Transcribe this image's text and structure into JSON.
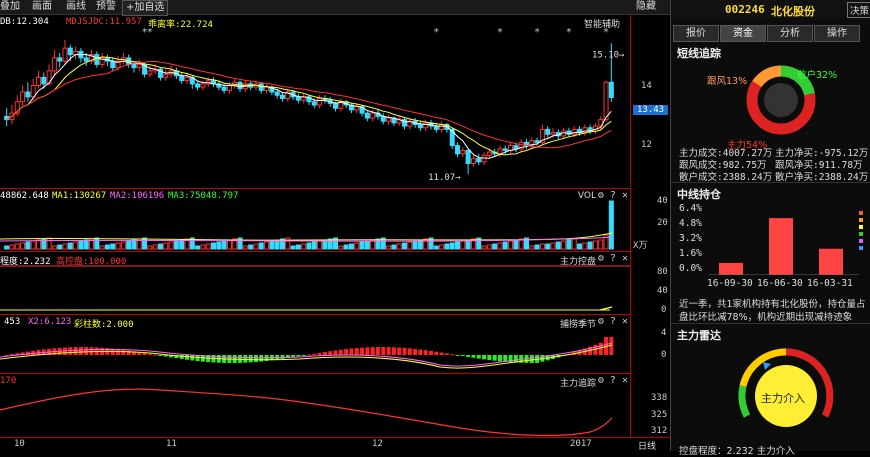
{
  "toolbar": {
    "items": [
      "叠加",
      "画面",
      "画线",
      "预警"
    ],
    "add_self": "+加自选",
    "hide": "隐藏"
  },
  "main_indicator": {
    "lines": [
      {
        "text": "DB:12.304",
        "color": "#ffffff"
      },
      {
        "text": "MDJSJDC:11.957",
        "color": "#ff3333"
      },
      {
        "text": "乖离率:22.724",
        "color": "#ffff33"
      }
    ],
    "helper": "智能辅助",
    "price_labels": [
      "14",
      "13.43",
      "12"
    ],
    "current_price": "13.43",
    "high_note": "15.10",
    "low_note": "11.07"
  },
  "chart_data": {
    "type": "candlestick",
    "title": "",
    "y_range": [
      10.8,
      15.6
    ],
    "x_ticks": [
      "10",
      "11",
      "12",
      "2017"
    ],
    "x_tick_index": [
      2,
      32,
      72,
      113
    ],
    "high_mark": {
      "index": 116,
      "value": 15.1
    },
    "low_mark": {
      "index": 87,
      "value": 11.07
    },
    "candles": [
      [
        12.85,
        12.75,
        13.1,
        12.55
      ],
      [
        12.75,
        12.95,
        13.2,
        12.6
      ],
      [
        12.95,
        13.3,
        13.5,
        12.85
      ],
      [
        13.3,
        13.6,
        13.8,
        13.2
      ],
      [
        13.6,
        13.45,
        13.9,
        13.3
      ],
      [
        13.45,
        13.8,
        14.0,
        13.35
      ],
      [
        13.8,
        14.05,
        14.25,
        13.7
      ],
      [
        14.05,
        13.85,
        14.2,
        13.7
      ],
      [
        13.85,
        14.25,
        14.45,
        13.8
      ],
      [
        14.25,
        14.65,
        14.9,
        14.1
      ],
      [
        14.65,
        14.55,
        14.8,
        14.35
      ],
      [
        14.55,
        14.95,
        15.2,
        14.45
      ],
      [
        14.95,
        14.75,
        15.05,
        14.55
      ],
      [
        14.75,
        14.85,
        15.0,
        14.6
      ],
      [
        14.85,
        14.65,
        14.95,
        14.5
      ],
      [
        14.65,
        14.55,
        14.8,
        14.4
      ],
      [
        14.55,
        14.75,
        14.9,
        14.45
      ],
      [
        14.75,
        14.45,
        14.85,
        14.35
      ],
      [
        14.45,
        14.65,
        14.8,
        14.35
      ],
      [
        14.65,
        14.55,
        14.75,
        14.4
      ],
      [
        14.55,
        14.35,
        14.65,
        14.25
      ],
      [
        14.35,
        14.55,
        14.7,
        14.25
      ],
      [
        14.55,
        14.65,
        14.8,
        14.45
      ],
      [
        14.65,
        14.45,
        14.75,
        14.35
      ],
      [
        14.45,
        14.35,
        14.55,
        14.2
      ],
      [
        14.35,
        14.45,
        14.6,
        14.25
      ],
      [
        14.45,
        14.15,
        14.5,
        14.05
      ],
      [
        14.15,
        14.25,
        14.4,
        14.05
      ],
      [
        14.25,
        14.3,
        14.45,
        14.15
      ],
      [
        14.3,
        14.05,
        14.35,
        13.95
      ],
      [
        14.05,
        14.15,
        14.3,
        13.95
      ],
      [
        14.15,
        14.25,
        14.4,
        14.05
      ],
      [
        14.25,
        14.1,
        14.35,
        14.0
      ],
      [
        14.1,
        13.95,
        14.2,
        13.85
      ],
      [
        13.95,
        14.05,
        14.15,
        13.85
      ],
      [
        14.05,
        13.85,
        14.1,
        13.7
      ],
      [
        13.85,
        13.75,
        13.95,
        13.65
      ],
      [
        13.75,
        13.85,
        13.95,
        13.65
      ],
      [
        13.85,
        13.95,
        14.05,
        13.75
      ],
      [
        13.95,
        13.85,
        14.05,
        13.75
      ],
      [
        13.85,
        13.75,
        13.95,
        13.65
      ],
      [
        13.75,
        13.65,
        13.85,
        13.55
      ],
      [
        13.65,
        13.8,
        13.9,
        13.55
      ],
      [
        13.8,
        13.9,
        14.0,
        13.7
      ],
      [
        13.9,
        13.7,
        13.95,
        13.6
      ],
      [
        13.7,
        13.85,
        13.95,
        13.6
      ],
      [
        13.85,
        13.75,
        13.95,
        13.65
      ],
      [
        13.75,
        13.85,
        13.95,
        13.65
      ],
      [
        13.85,
        13.65,
        13.9,
        13.55
      ],
      [
        13.65,
        13.75,
        13.85,
        13.55
      ],
      [
        13.75,
        13.6,
        13.8,
        13.5
      ],
      [
        13.6,
        13.5,
        13.7,
        13.4
      ],
      [
        13.5,
        13.4,
        13.6,
        13.3
      ],
      [
        13.4,
        13.6,
        13.7,
        13.3
      ],
      [
        13.6,
        13.45,
        13.65,
        13.35
      ],
      [
        13.45,
        13.35,
        13.55,
        13.25
      ],
      [
        13.35,
        13.45,
        13.55,
        13.25
      ],
      [
        13.45,
        13.3,
        13.5,
        13.2
      ],
      [
        13.3,
        13.2,
        13.4,
        13.1
      ],
      [
        13.2,
        13.4,
        13.5,
        13.1
      ],
      [
        13.4,
        13.35,
        13.5,
        13.25
      ],
      [
        13.35,
        13.25,
        13.45,
        13.15
      ],
      [
        13.25,
        13.1,
        13.3,
        13.0
      ],
      [
        13.1,
        13.3,
        13.4,
        13.0
      ],
      [
        13.3,
        13.2,
        13.35,
        13.1
      ],
      [
        13.2,
        13.05,
        13.25,
        12.95
      ],
      [
        13.05,
        13.15,
        13.25,
        12.95
      ],
      [
        13.15,
        12.95,
        13.2,
        12.85
      ],
      [
        12.95,
        12.8,
        13.0,
        12.7
      ],
      [
        12.8,
        12.95,
        13.05,
        12.7
      ],
      [
        12.95,
        12.85,
        13.05,
        12.75
      ],
      [
        12.85,
        12.7,
        12.95,
        12.6
      ],
      [
        12.7,
        12.8,
        12.9,
        12.6
      ],
      [
        12.8,
        12.65,
        12.85,
        12.55
      ],
      [
        12.65,
        12.75,
        12.85,
        12.55
      ],
      [
        12.75,
        12.55,
        12.8,
        12.45
      ],
      [
        12.55,
        12.7,
        12.8,
        12.45
      ],
      [
        12.7,
        12.6,
        12.8,
        12.5
      ],
      [
        12.6,
        12.5,
        12.7,
        12.4
      ],
      [
        12.5,
        12.65,
        12.75,
        12.4
      ],
      [
        12.65,
        12.55,
        12.75,
        12.45
      ],
      [
        12.55,
        12.45,
        12.65,
        12.35
      ],
      [
        12.45,
        12.6,
        12.7,
        12.35
      ],
      [
        12.6,
        12.45,
        12.65,
        12.35
      ],
      [
        12.45,
        11.95,
        12.5,
        11.85
      ],
      [
        11.95,
        11.7,
        12.05,
        11.6
      ],
      [
        11.7,
        11.8,
        11.9,
        11.6
      ],
      [
        11.8,
        11.4,
        11.85,
        11.07
      ],
      [
        11.4,
        11.55,
        11.65,
        11.3
      ],
      [
        11.55,
        11.45,
        11.7,
        11.35
      ],
      [
        11.45,
        11.65,
        11.75,
        11.35
      ],
      [
        11.65,
        11.75,
        11.85,
        11.55
      ],
      [
        11.75,
        11.7,
        11.85,
        11.6
      ],
      [
        11.7,
        11.85,
        11.95,
        11.6
      ],
      [
        11.85,
        11.8,
        11.95,
        11.7
      ],
      [
        11.8,
        11.95,
        12.05,
        11.7
      ],
      [
        11.95,
        11.85,
        12.05,
        11.75
      ],
      [
        11.85,
        12.05,
        12.15,
        11.75
      ],
      [
        12.05,
        11.95,
        12.15,
        11.85
      ],
      [
        11.95,
        12.1,
        12.2,
        11.85
      ],
      [
        12.1,
        12.05,
        12.2,
        11.95
      ],
      [
        12.05,
        12.45,
        12.6,
        12.0
      ],
      [
        12.45,
        12.3,
        12.55,
        12.2
      ],
      [
        12.3,
        12.35,
        12.5,
        12.2
      ],
      [
        12.35,
        12.25,
        12.45,
        12.15
      ],
      [
        12.25,
        12.4,
        12.5,
        12.15
      ],
      [
        12.4,
        12.3,
        12.5,
        12.2
      ],
      [
        12.3,
        12.45,
        12.55,
        12.2
      ],
      [
        12.45,
        12.35,
        12.55,
        12.25
      ],
      [
        12.35,
        12.5,
        12.6,
        12.25
      ],
      [
        12.5,
        12.4,
        12.6,
        12.3
      ],
      [
        12.4,
        12.55,
        12.65,
        12.3
      ],
      [
        12.55,
        12.75,
        12.85,
        12.45
      ],
      [
        12.75,
        13.9,
        13.95,
        12.7
      ],
      [
        13.9,
        13.43,
        15.1,
        13.3
      ]
    ],
    "ma_lines": [
      {
        "name": "MA5",
        "color": "#ffffff",
        "values": []
      },
      {
        "name": "MA10",
        "color": "#ffff33",
        "values": []
      },
      {
        "name": "MA20",
        "color": "#ff3333",
        "values": []
      }
    ]
  },
  "volume_pane": {
    "lines": [
      {
        "text": "48862.648",
        "color": "#ffffff"
      },
      {
        "text": "MA1:130267",
        "color": "#ffff33"
      },
      {
        "text": "MA2:106196",
        "color": "#ff66ff"
      },
      {
        "text": "MA3:75048.797",
        "color": "#33ff33"
      }
    ],
    "title": "VOL",
    "y_labels": [
      "40",
      "20"
    ],
    "unit": "X万"
  },
  "control_pane": {
    "lines": [
      {
        "text": "程度:2.232",
        "color": "#ffffff"
      },
      {
        "text": "高控盘:100.000",
        "color": "#ff3333"
      }
    ],
    "title": "主力控盘",
    "y_labels": [
      "80",
      "40",
      "0"
    ]
  },
  "season_pane": {
    "lines": [
      {
        "text": "453",
        "color": "#ffffff"
      },
      {
        "text": "X2:6.123",
        "color": "#ff66ff"
      },
      {
        "text": "彩柱数:2.000",
        "color": "#ffff33"
      }
    ],
    "title": "捕捞季节",
    "y_labels": [
      "4",
      "0"
    ]
  },
  "track_pane": {
    "lines": [
      {
        "text": "170",
        "color": "#ff3333"
      }
    ],
    "title": "主力追踪",
    "y_labels": [
      "338",
      "325",
      "312"
    ]
  },
  "x_axis": {
    "labels": [
      "10",
      "11",
      "12",
      "2017"
    ],
    "period": "日线"
  },
  "right_panel": {
    "stock_code": "002246",
    "stock_name": "北化股份",
    "decide_btn": "决策",
    "tabs": [
      "报价",
      "资金",
      "分析",
      "操作"
    ],
    "active_tab": "资金",
    "short_title": "短线追踪",
    "donut": [
      {
        "label": "跟风13%",
        "color": "#ff6b6b",
        "value": 13
      },
      {
        "label": "散户32%",
        "color": "#33cc33",
        "value": 32
      },
      {
        "label": "主力54%",
        "color": "#dd2222",
        "value": 54
      }
    ],
    "flow_rows": [
      [
        "主力成交:4007.27万",
        "主力净买:-975.12万"
      ],
      [
        "跟风成交:982.75万",
        "跟风净买:911.78万"
      ],
      [
        "散户成交:2388.24万",
        "散户净买:2388.24万"
      ]
    ],
    "mid_title": "中线持仓",
    "bar_y_labels": [
      "6.4%",
      "4.8%",
      "3.2%",
      "1.6%",
      "0.0%"
    ],
    "bar_chart": {
      "categories": [
        "16-09-30",
        "16-06-30",
        "16-03-31"
      ],
      "values": [
        1.1,
        5.2,
        2.4
      ],
      "ylim": [
        0,
        6.4
      ]
    },
    "mid_text_1": "近一季，共1家机构持有北化股份，持仓量占",
    "mid_text_2": "盘比环比减78%，机构近期出现减持迹象",
    "radar_title": "主力雷达",
    "gauge_label": "主力介入",
    "bottom_text": "控盘程度：2.232 主力介入"
  }
}
